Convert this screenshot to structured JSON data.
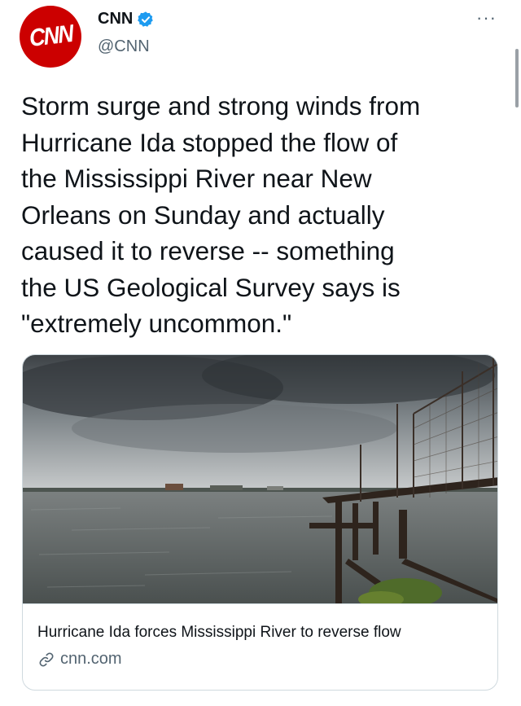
{
  "account": {
    "avatar_text": "CNN",
    "name": "CNN",
    "handle": "@CNN",
    "verified_icon": "verified-badge-icon"
  },
  "more_label": "···",
  "tweet": {
    "text": "Storm surge and strong winds from\nHurricane Ida stopped the flow of\nthe Mississippi River near New\nOrleans on Sunday and actually\ncaused it to reverse -- something\nthe US Geological Survey says is\n\"extremely uncommon.\""
  },
  "card": {
    "title": "Hurricane Ida forces Mississippi River to reverse flow",
    "domain": "cnn.com",
    "link_icon": "link-icon"
  },
  "colors": {
    "brand": "#cc0000",
    "verified": "#1d9bf0",
    "secondary_text": "#536471",
    "border": "#cfd9de"
  }
}
